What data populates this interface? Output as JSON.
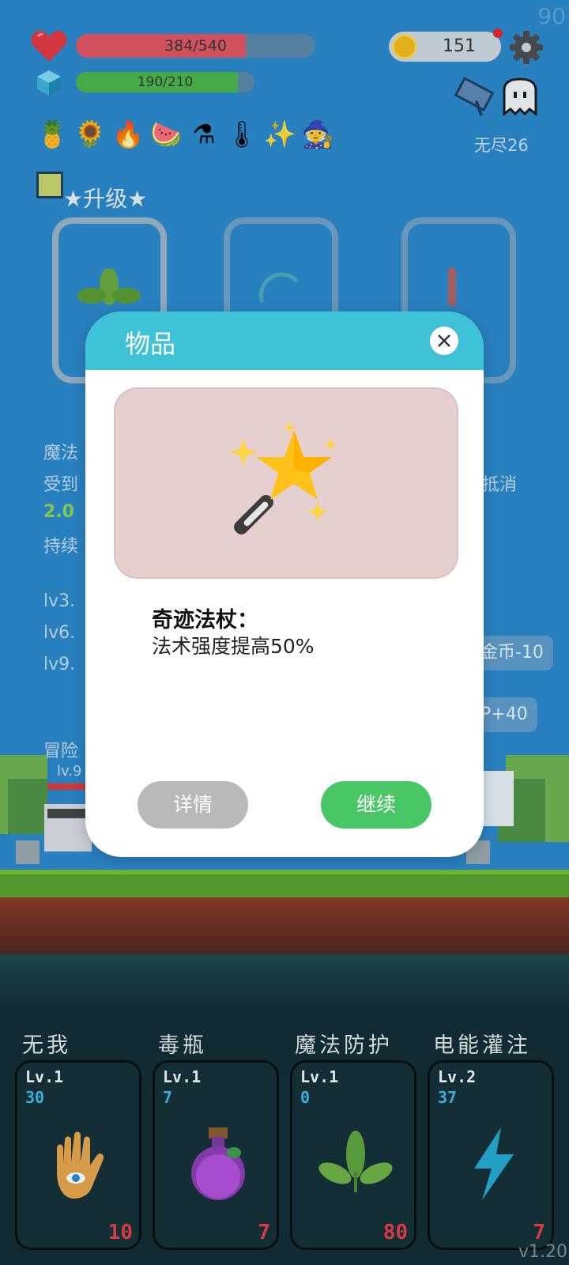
{
  "fps": "90",
  "hud": {
    "hp_text": "384/540",
    "hp_fraction": 0.711,
    "mp_text": "190/210",
    "mp_fraction": 0.905,
    "coins": "151",
    "mode_label": "无尽26",
    "hp_color": "#e0535e",
    "mp_color": "#49b547"
  },
  "items": [
    "pineapple-icon",
    "sunflower-icon",
    "fire-ring-icon",
    "watermelon-icon",
    "flask-icon",
    "thermometer-icon",
    "magic-wand-icon",
    "wizard-hat-icon"
  ],
  "upgrade": {
    "title": "★升级★"
  },
  "background_text": {
    "line1": "魔法",
    "line2": "受到",
    "line2_right": "抵消",
    "line3": "2.0",
    "line4": "持续",
    "lv3": "lv3.",
    "lv6": "lv6.",
    "lv9": "lv9.",
    "btn_coin": "金币-10",
    "btn_xp": "P+40",
    "adventure": "冒险",
    "hero_lv": "lv.9"
  },
  "modal": {
    "title": "物品",
    "item_name": "奇迹法杖：",
    "item_desc": "法术强度提高50%",
    "details_label": "详情",
    "continue_label": "继续",
    "header_color": "#3ec3d6",
    "continue_color": "#49c766"
  },
  "skills": [
    {
      "name": "无我",
      "level": "Lv.1",
      "xp": "30",
      "cost": "10"
    },
    {
      "name": "毒瓶",
      "level": "Lv.1",
      "xp": "7",
      "cost": "7"
    },
    {
      "name": "魔法防护",
      "level": "Lv.1",
      "xp": "0",
      "cost": "80"
    },
    {
      "name": "电能灌注",
      "level": "Lv.2",
      "xp": "37",
      "cost": "7"
    }
  ],
  "version": "v1.20"
}
